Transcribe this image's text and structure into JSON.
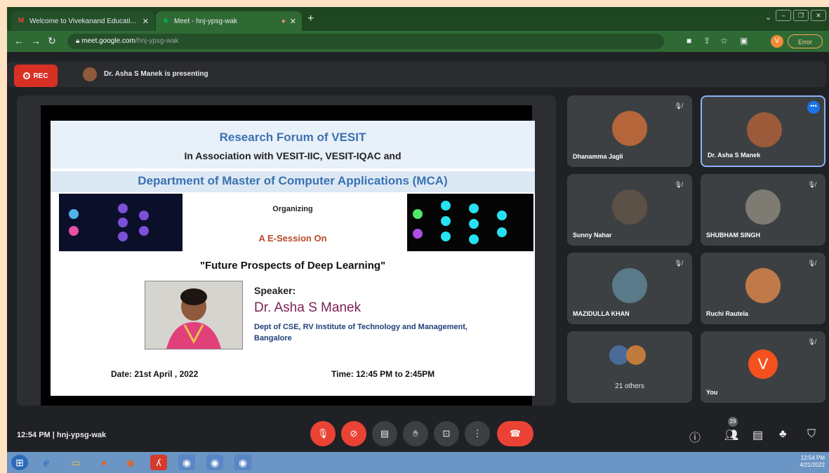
{
  "browser": {
    "tab1_title": "Welcome to Vivekanand Educati...",
    "tab2_title": "Meet - hnj-ypsg-wak",
    "url_host": "meet.google.com",
    "url_path": "/hnj-ypsg-wak",
    "profile_letter": "V",
    "error_label": "Error"
  },
  "meet": {
    "rec_label": "REC",
    "presenting_text": "Dr. Asha S Manek is presenting",
    "time_code": "12:54 PM  |  hnj-ypsg-wak",
    "participants_count": "29"
  },
  "slide": {
    "title1": "Research Forum of VESIT",
    "title2": "In Association with VESIT-IIC, VESIT-IQAC and",
    "title3": "Department of Master of Computer Applications (MCA)",
    "organizing": "Organizing",
    "session": "A E-Session On",
    "topic": "\"Future Prospects of Deep Learning\"",
    "speaker_label": "Speaker:",
    "speaker_name": "Dr. Asha S Manek",
    "speaker_dept": "Dept of CSE, RV Institute of Technology and Management, Bangalore",
    "date": "Date: 21st April , 2022",
    "time": "Time: 12:45 PM to 2:45PM"
  },
  "tiles": [
    {
      "name": "Dhanamma Jagli",
      "color": "#b5653a"
    },
    {
      "name": "Dr. Asha S Manek",
      "color": "#9b5a3a"
    },
    {
      "name": "Sunny Nahar",
      "color": "#5b5146"
    },
    {
      "name": "SHUBHAM SINGH",
      "color": "#7d7b72"
    },
    {
      "name": "MAZIDULLA KHAN",
      "color": "#5a7a8a"
    },
    {
      "name": "Ruchi Rautela",
      "color": "#c07a4a"
    },
    {
      "name": "21 others",
      "color": "#4a6a9a"
    },
    {
      "name": "You",
      "letter": "V",
      "color": "#f4511e"
    }
  ],
  "taskbar": {
    "clock_time": "12:54 PM",
    "clock_date": "4/21/2022"
  }
}
